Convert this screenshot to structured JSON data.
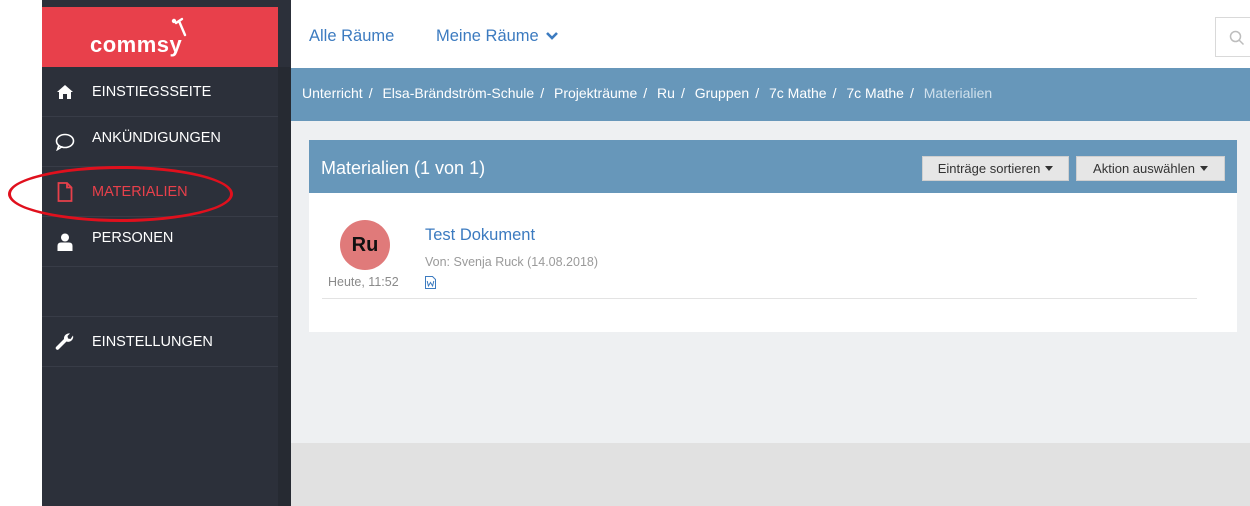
{
  "logo": {
    "text": "comṃsy",
    "word": "commsy"
  },
  "sidebar": {
    "items": [
      {
        "label": "EINSTIEGSSEITE",
        "icon": "home-icon"
      },
      {
        "label": "ANKÜNDIGUNGEN",
        "icon": "speech-bubble-icon"
      },
      {
        "label": "MATERIALIEN",
        "icon": "document-icon",
        "active": true
      },
      {
        "label": "PERSONEN",
        "icon": "person-icon"
      },
      {
        "label": "EINSTELLUNGEN",
        "icon": "wrench-icon"
      }
    ]
  },
  "topbar": {
    "all_rooms": "Alle Räume",
    "my_rooms": "Meine Räume"
  },
  "breadcrumb": {
    "items": [
      "Unterricht",
      "Elsa-Brändström-Schule",
      "Projekträume",
      "Ru",
      "Gruppen",
      "7c Mathe",
      "7c Mathe"
    ],
    "current": "Materialien",
    "separator": "/"
  },
  "panel": {
    "title": "Materialien (1 von 1)",
    "sort_label": "Einträge sortieren",
    "action_label": "Aktion auswählen"
  },
  "entry": {
    "avatar_initials": "Ru",
    "time": "Heute, 11:52",
    "title": "Test Dokument",
    "meta": "Von: Svenja Ruck (14.08.2018)",
    "file_icon": "word-file-icon"
  },
  "colors": {
    "brand_red": "#e8404b",
    "sidebar_bg": "#2c303a",
    "header_blue": "#6797ba",
    "link_blue": "#3c7bc0",
    "highlight_red": "#e0101d"
  }
}
